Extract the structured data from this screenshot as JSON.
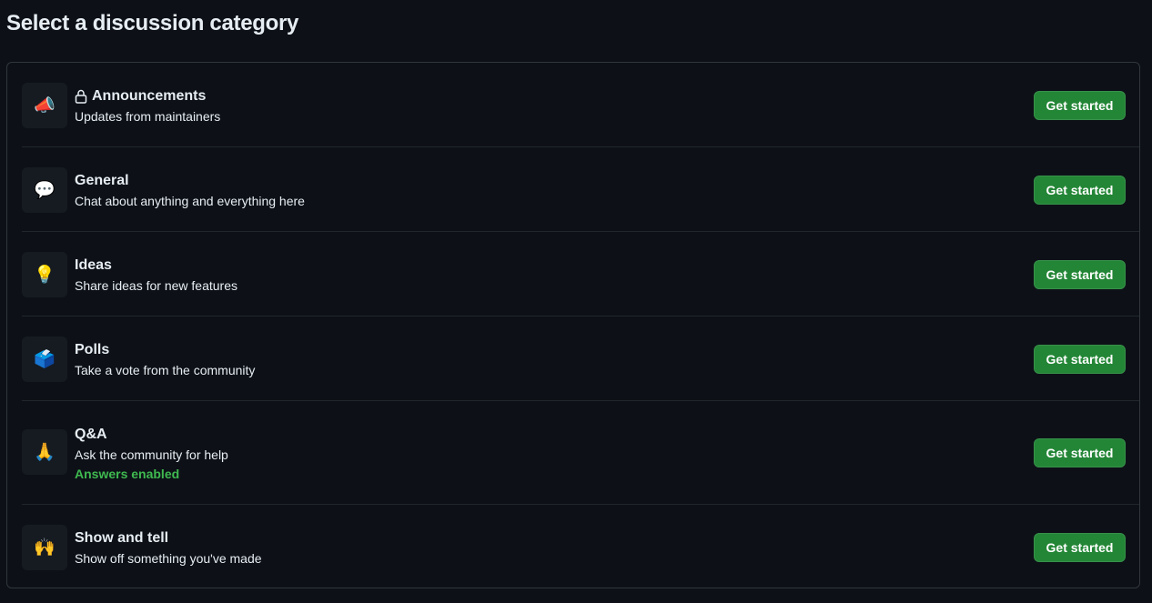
{
  "page": {
    "title": "Select a discussion category"
  },
  "colors": {
    "background": "#0d1117",
    "border": "#30363d",
    "button": "#238636",
    "answers_enabled": "#3fb950"
  },
  "categories": [
    {
      "emoji": "📣",
      "icon": "megaphone-icon",
      "locked": true,
      "title": "Announcements",
      "description": "Updates from maintainers",
      "note": "",
      "button_label": "Get started"
    },
    {
      "emoji": "💬",
      "icon": "speech-bubble-icon",
      "locked": false,
      "title": "General",
      "description": "Chat about anything and everything here",
      "note": "",
      "button_label": "Get started"
    },
    {
      "emoji": "💡",
      "icon": "light-bulb-icon",
      "locked": false,
      "title": "Ideas",
      "description": "Share ideas for new features",
      "note": "",
      "button_label": "Get started"
    },
    {
      "emoji": "🗳️",
      "icon": "ballot-box-icon",
      "locked": false,
      "title": "Polls",
      "description": "Take a vote from the community",
      "note": "",
      "button_label": "Get started"
    },
    {
      "emoji": "🙏",
      "icon": "folded-hands-icon",
      "locked": false,
      "title": "Q&A",
      "description": "Ask the community for help",
      "note": "Answers enabled",
      "button_label": "Get started"
    },
    {
      "emoji": "🙌",
      "icon": "raising-hands-icon",
      "locked": false,
      "title": "Show and tell",
      "description": "Show off something you've made",
      "note": "",
      "button_label": "Get started"
    }
  ]
}
